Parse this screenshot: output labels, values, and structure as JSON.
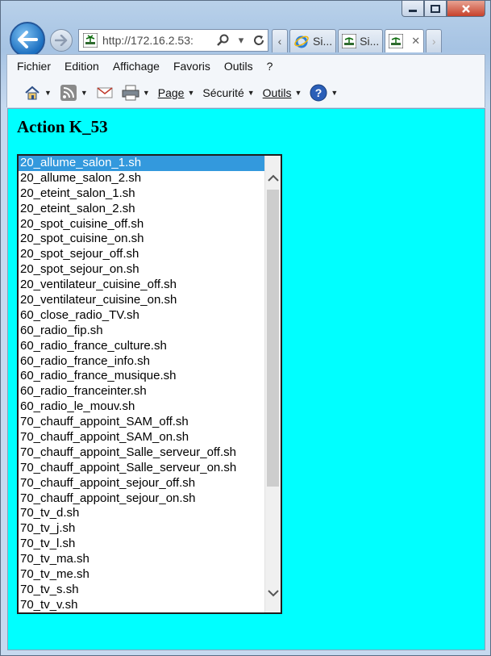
{
  "browser": {
    "url": "http://172.16.2.53:",
    "tabs": [
      {
        "label": "Si..."
      },
      {
        "label": "Si..."
      },
      {
        "label": ""
      }
    ],
    "tab_close": "✕",
    "menu": [
      "Fichier",
      "Edition",
      "Affichage",
      "Favoris",
      "Outils",
      "?"
    ],
    "commands": {
      "page": "Page",
      "securite": "Sécurité",
      "outils": "Outils"
    }
  },
  "page": {
    "title": "Action K_53",
    "list": {
      "selected_index": 0,
      "items": [
        "20_allume_salon_1.sh",
        "20_allume_salon_2.sh",
        "20_eteint_salon_1.sh",
        "20_eteint_salon_2.sh",
        "20_spot_cuisine_off.sh",
        "20_spot_cuisine_on.sh",
        "20_spot_sejour_off.sh",
        "20_spot_sejour_on.sh",
        "20_ventilateur_cuisine_off.sh",
        "20_ventilateur_cuisine_on.sh",
        "60_close_radio_TV.sh",
        "60_radio_fip.sh",
        "60_radio_france_culture.sh",
        "60_radio_france_info.sh",
        "60_radio_france_musique.sh",
        "60_radio_franceinter.sh",
        "60_radio_le_mouv.sh",
        "70_chauff_appoint_SAM_off.sh",
        "70_chauff_appoint_SAM_on.sh",
        "70_chauff_appoint_Salle_serveur_off.sh",
        "70_chauff_appoint_Salle_serveur_on.sh",
        "70_chauff_appoint_sejour_off.sh",
        "70_chauff_appoint_sejour_on.sh",
        "70_tv_d.sh",
        "70_tv_j.sh",
        "70_tv_l.sh",
        "70_tv_ma.sh",
        "70_tv_me.sh",
        "70_tv_s.sh",
        "70_tv_v.sh"
      ]
    }
  },
  "colors": {
    "content_bg": "#00ffff",
    "selection_bg": "#3399dd"
  }
}
